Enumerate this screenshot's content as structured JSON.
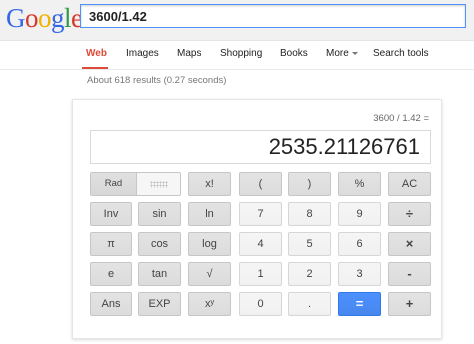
{
  "logo": {
    "letters": [
      "G",
      "o",
      "o",
      "g",
      "l",
      "e"
    ],
    "colors": [
      "#3366e8",
      "#d6392b",
      "#f0b300",
      "#3366e8",
      "#2f9c45",
      "#d6392b"
    ]
  },
  "search": {
    "value": "3600/1.42"
  },
  "nav": {
    "items": [
      {
        "id": "web",
        "label": "Web",
        "active": true
      },
      {
        "id": "images",
        "label": "Images"
      },
      {
        "id": "maps",
        "label": "Maps"
      },
      {
        "id": "shopping",
        "label": "Shopping"
      },
      {
        "id": "books",
        "label": "Books"
      },
      {
        "id": "more",
        "label": "More",
        "icon": "caret-down-icon"
      },
      {
        "id": "search-tools",
        "label": "Search tools"
      }
    ]
  },
  "result_stats": "About 618 results (0.27 seconds)",
  "calculator": {
    "history": "3600 / 1.42 =",
    "display": "2535.21126761",
    "mode": {
      "rad_label": "Rad",
      "deg_state": "inactive"
    },
    "rows": [
      [
        "x!",
        "(",
        ")",
        "%",
        "AC"
      ],
      [
        "Inv",
        "sin",
        "ln",
        "7",
        "8",
        "9",
        "÷"
      ],
      [
        "π",
        "cos",
        "log",
        "4",
        "5",
        "6",
        "×"
      ],
      [
        "e",
        "tan",
        "√",
        "1",
        "2",
        "3",
        "-"
      ],
      [
        "Ans",
        "EXP",
        "xʸ",
        "0",
        ".",
        "=",
        "+"
      ]
    ],
    "accent_color": "#4d90fe"
  }
}
